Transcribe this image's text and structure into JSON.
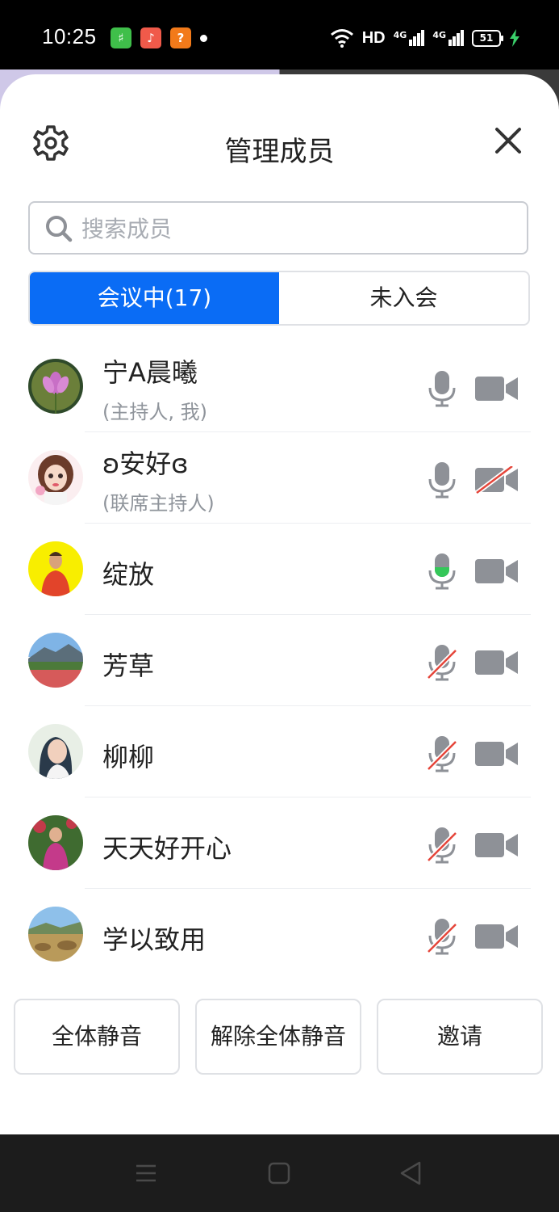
{
  "status_bar": {
    "time": "10:25",
    "hd": "HD",
    "battery": "51",
    "net1": "4G",
    "net2": "4G"
  },
  "header": {
    "title": "管理成员"
  },
  "search": {
    "placeholder": "搜索成员"
  },
  "tabs": [
    {
      "label": "会议中(17)",
      "active": true
    },
    {
      "label": "未入会",
      "active": false
    }
  ],
  "members": [
    {
      "name": "宁A晨曦",
      "role": "(主持人, 我)",
      "mic": "on",
      "camera": "on"
    },
    {
      "name": "ʚ安好ɞ",
      "role": "(联席主持人)",
      "mic": "on",
      "camera": "off"
    },
    {
      "name": "绽放",
      "role": "",
      "mic": "speaking",
      "camera": "on"
    },
    {
      "name": "芳草",
      "role": "",
      "mic": "muted",
      "camera": "on"
    },
    {
      "name": "柳柳",
      "role": "",
      "mic": "muted",
      "camera": "on"
    },
    {
      "name": "天天好开心",
      "role": "",
      "mic": "muted",
      "camera": "on"
    },
    {
      "name": "学以致用",
      "role": "",
      "mic": "muted",
      "camera": "on"
    }
  ],
  "actions": {
    "mute_all": "全体静音",
    "unmute_all": "解除全体静音",
    "invite": "邀请"
  },
  "colors": {
    "accent": "#0a6cf5",
    "speaking": "#34c759",
    "muted_slash": "#e5453a",
    "icon_gray": "#8e9197"
  }
}
